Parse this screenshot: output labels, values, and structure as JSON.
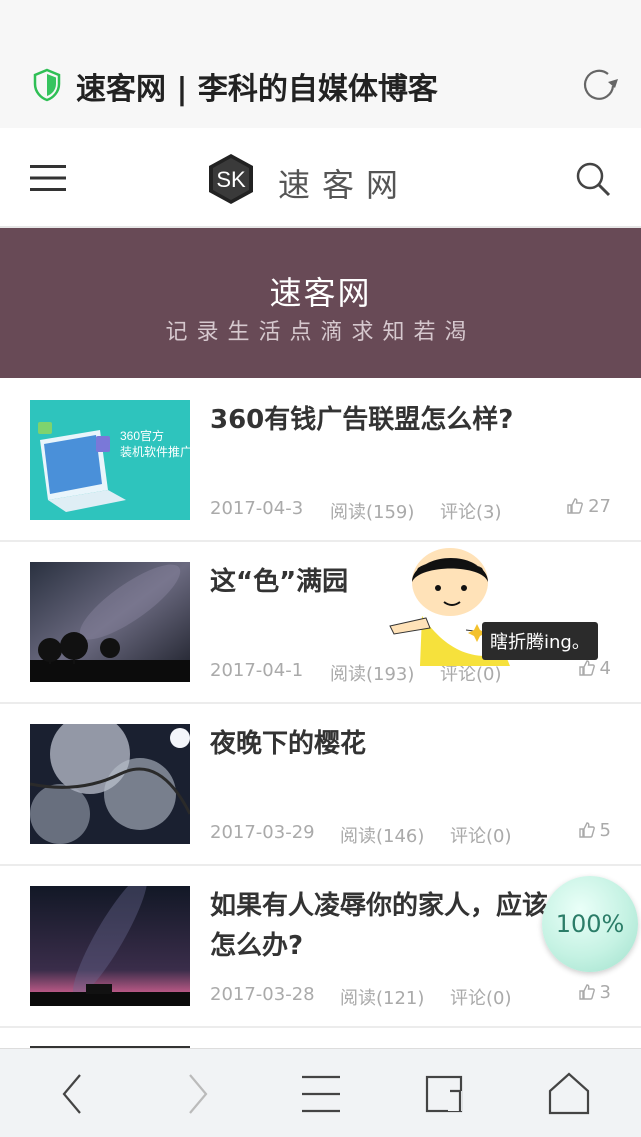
{
  "browser": {
    "page_title": "速客网 | 李科的自媒体博客",
    "icons": {
      "security": "shield-check-icon",
      "reload": "reload-icon"
    }
  },
  "header": {
    "logo_mark": "SK",
    "logo_text": "速客网",
    "icons": {
      "menu": "hamburger-menu-icon",
      "search": "search-icon"
    }
  },
  "banner": {
    "title": "速客网",
    "subtitle": "记录生活点滴求知若渴",
    "background": "#684a56"
  },
  "posts": [
    {
      "title": "360有钱广告联盟怎么样?",
      "date": "2017-04-3",
      "reads": "阅读(159)",
      "comments": "评论(3)",
      "likes": "27"
    },
    {
      "title": "这“色”满园",
      "date": "2017-04-1",
      "reads": "阅读(193)",
      "comments": "评论(0)",
      "likes": "4"
    },
    {
      "title": "夜晚下的樱花",
      "date": "2017-03-29",
      "reads": "阅读(146)",
      "comments": "评论(0)",
      "likes": "5"
    },
    {
      "title": "如果有人凌辱你的家人，应该怎么办?",
      "date": "2017-03-28",
      "reads": "阅读(121)",
      "comments": "评论(0)",
      "likes": "3"
    }
  ],
  "thumb1_text": {
    "line1": "360官方",
    "line2": "装机软件推广"
  },
  "mascot": {
    "bubble": "瞎折腾ing。"
  },
  "zoom": {
    "label": "100%"
  },
  "toolbar": {
    "icons": [
      "back-icon",
      "forward-icon",
      "menu-icon",
      "tabs-icon",
      "home-icon"
    ]
  }
}
